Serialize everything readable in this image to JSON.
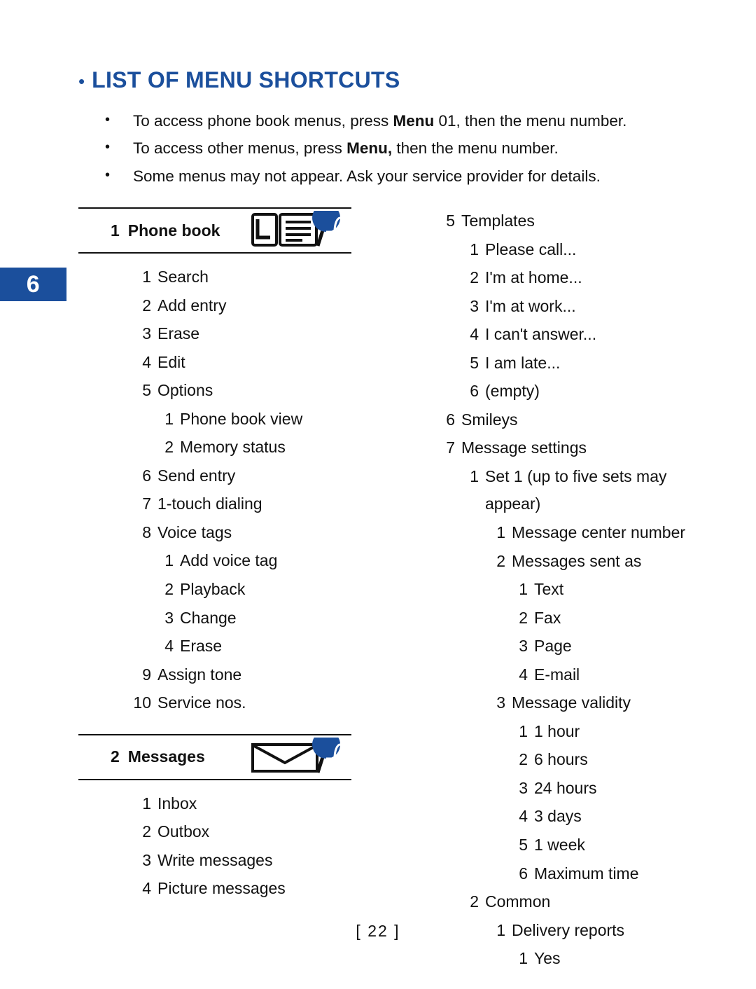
{
  "page": {
    "tab_number": "6",
    "footer": "[ 22 ]",
    "title": "LIST OF MENU SHORTCUTS",
    "title_bullet": "•",
    "accent_color": "#1b4f9c"
  },
  "intro": [
    {
      "bullet": "•",
      "pre": "To access phone book menus, press ",
      "strong": "Menu",
      "post": " 01, then the menu number."
    },
    {
      "bullet": "•",
      "pre": "To access other menus, press ",
      "strong": "Menu,",
      "post": " then the menu number."
    },
    {
      "bullet": "•",
      "pre": "Some menus may not appear. Ask your service provider for details.",
      "strong": "",
      "post": ""
    }
  ],
  "left_column": {
    "sections": [
      {
        "number": "1",
        "label": "Phone book",
        "icon": "phonebook-icon",
        "entries": [
          {
            "level": 1,
            "n": "1",
            "t": "Search"
          },
          {
            "level": 1,
            "n": "2",
            "t": "Add entry"
          },
          {
            "level": 1,
            "n": "3",
            "t": "Erase"
          },
          {
            "level": 1,
            "n": "4",
            "t": "Edit"
          },
          {
            "level": 1,
            "n": "5",
            "t": "Options"
          },
          {
            "level": 2,
            "n": "1",
            "t": "Phone book view"
          },
          {
            "level": 2,
            "n": "2",
            "t": "Memory status"
          },
          {
            "level": 1,
            "n": "6",
            "t": "Send entry"
          },
          {
            "level": 1,
            "n": "7",
            "t": "1-touch dialing"
          },
          {
            "level": 1,
            "n": "8",
            "t": "Voice tags"
          },
          {
            "level": 2,
            "n": "1",
            "t": "Add voice tag"
          },
          {
            "level": 2,
            "n": "2",
            "t": "Playback"
          },
          {
            "level": 2,
            "n": "3",
            "t": "Change"
          },
          {
            "level": 2,
            "n": "4",
            "t": "Erase"
          },
          {
            "level": 1,
            "n": "9",
            "t": "Assign tone"
          },
          {
            "level": 1,
            "n": "10",
            "t": "Service nos."
          }
        ]
      },
      {
        "number": "2",
        "label": "Messages",
        "icon": "envelope-icon",
        "entries": [
          {
            "level": 1,
            "n": "1",
            "t": "Inbox"
          },
          {
            "level": 1,
            "n": "2",
            "t": "Outbox"
          },
          {
            "level": 1,
            "n": "3",
            "t": "Write messages"
          },
          {
            "level": 1,
            "n": "4",
            "t": "Picture messages"
          }
        ]
      }
    ]
  },
  "right_column": {
    "entries": [
      {
        "level": 1,
        "n": "5",
        "t": "Templates"
      },
      {
        "level": 2,
        "n": "1",
        "t": "Please call..."
      },
      {
        "level": 2,
        "n": "2",
        "t": "I'm at home..."
      },
      {
        "level": 2,
        "n": "3",
        "t": "I'm at work..."
      },
      {
        "level": 2,
        "n": "4",
        "t": "I can't answer..."
      },
      {
        "level": 2,
        "n": "5",
        "t": "I am late..."
      },
      {
        "level": 2,
        "n": "6",
        "t": "(empty)"
      },
      {
        "level": 1,
        "n": "6",
        "t": "Smileys"
      },
      {
        "level": 1,
        "n": "7",
        "t": "Message settings"
      },
      {
        "level": 2,
        "n": "1",
        "t": "Set 1 (up to five sets may appear)"
      },
      {
        "level": 3,
        "n": "1",
        "t": "Message center number"
      },
      {
        "level": 3,
        "n": "2",
        "t": "Messages sent as"
      },
      {
        "level": 4,
        "n": "1",
        "t": "Text"
      },
      {
        "level": 4,
        "n": "2",
        "t": "Fax"
      },
      {
        "level": 4,
        "n": "3",
        "t": "Page"
      },
      {
        "level": 4,
        "n": "4",
        "t": "E-mail"
      },
      {
        "level": 3,
        "n": "3",
        "t": "Message validity"
      },
      {
        "level": 4,
        "n": "1",
        "t": "1 hour"
      },
      {
        "level": 4,
        "n": "2",
        "t": "6 hours"
      },
      {
        "level": 4,
        "n": "3",
        "t": "24 hours"
      },
      {
        "level": 4,
        "n": "4",
        "t": "3 days"
      },
      {
        "level": 4,
        "n": "5",
        "t": "1 week"
      },
      {
        "level": 4,
        "n": "6",
        "t": "Maximum time"
      },
      {
        "level": 2,
        "n": "2",
        "t": "Common"
      },
      {
        "level": 3,
        "n": "1",
        "t": "Delivery reports"
      },
      {
        "level": 4,
        "n": "1",
        "t": "Yes"
      }
    ]
  }
}
